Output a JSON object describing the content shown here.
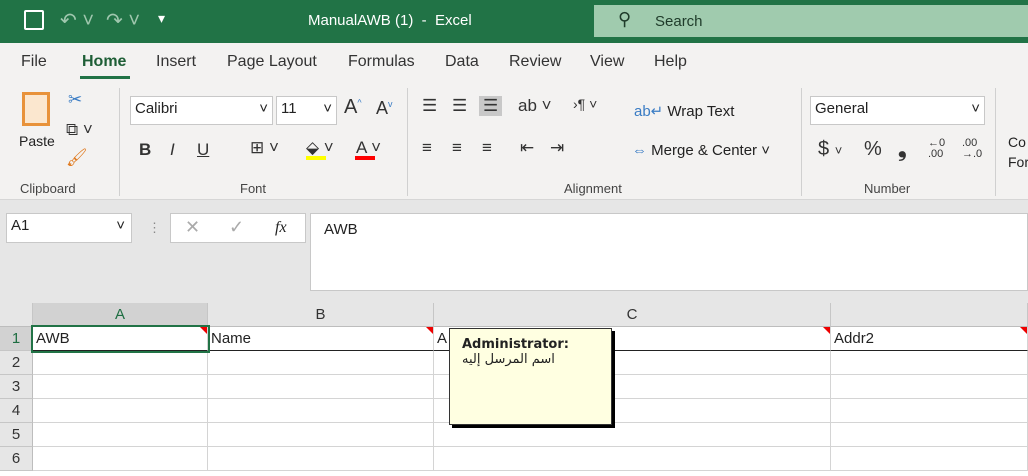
{
  "title": {
    "doc": "ManualAWB (1)  -  Excel",
    "search": "Search"
  },
  "tabs": [
    "File",
    "Home",
    "Insert",
    "Page Layout",
    "Formulas",
    "Data",
    "Review",
    "View",
    "Help"
  ],
  "active_tab": "Home",
  "ribbon": {
    "paste": "Paste",
    "clipboard": "Clipboard",
    "font_name": "Calibri",
    "font_size": "11",
    "font": "Font",
    "bold": "B",
    "italic": "I",
    "underline": "U",
    "wrap_text": "Wrap Text",
    "merge_center": "Merge & Center",
    "alignment": "Alignment",
    "number_format": "General",
    "number": "Number",
    "dollar": "$",
    "percent": "%",
    "comma": "❟",
    "cond_format": "Co\nFor",
    "fill_color": "#ffff00",
    "font_color": "#ff0000"
  },
  "formula_bar": {
    "name_box": "A1",
    "fx": "fx",
    "value": "AWB"
  },
  "columns": [
    "A",
    "B",
    "C"
  ],
  "rows": [
    "1",
    "2",
    "3",
    "4",
    "5",
    "6"
  ],
  "cells": {
    "A1": "AWB",
    "B1": "Name",
    "C1": "A",
    "D1": "Addr2"
  },
  "comment": {
    "author": "Administrator:",
    "text": "اسم المرسل إليه"
  }
}
